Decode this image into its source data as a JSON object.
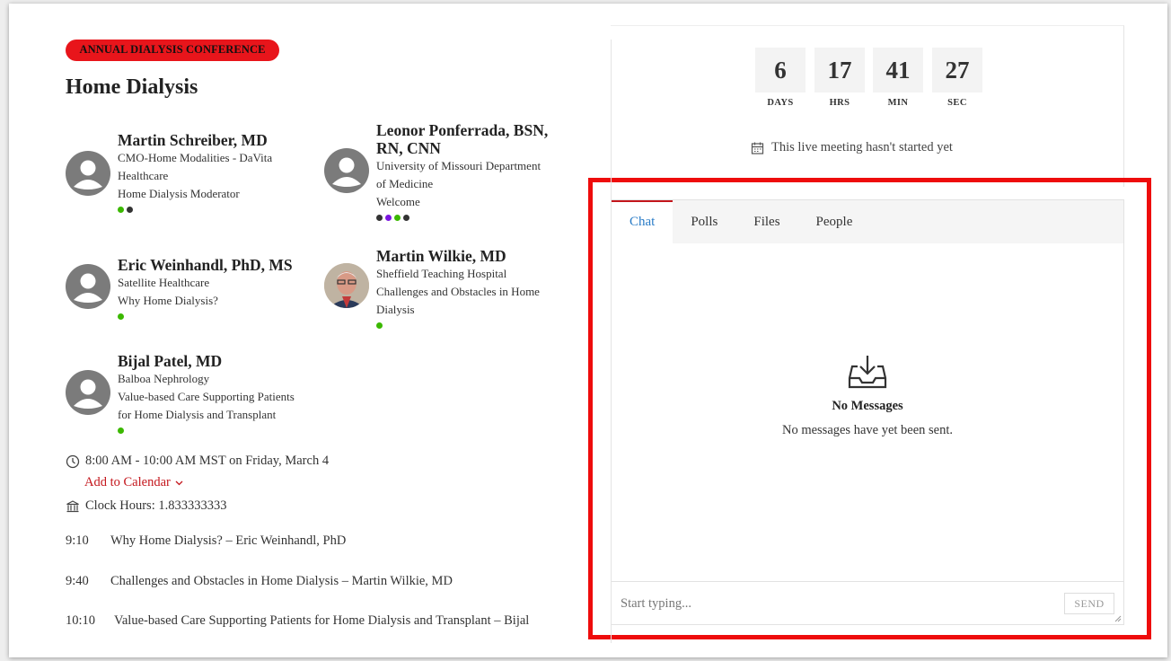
{
  "event": {
    "badge": "ANNUAL DIALYSIS CONFERENCE",
    "title": "Home Dialysis"
  },
  "speakers": [
    {
      "name": "Martin Schreiber, MD",
      "lines": [
        "CMO-Home Modalities - DaVita",
        "Healthcare",
        "Home Dialysis Moderator"
      ],
      "dots": [
        "#3bb800",
        "#333333"
      ]
    },
    {
      "name_lines": [
        "Leonor Ponferrada, BSN,",
        "RN, CNN"
      ],
      "lines": [
        "University of Missouri Department",
        "of Medicine",
        "Welcome"
      ],
      "dots": [
        "#333333",
        "#7b16e0",
        "#3bb800",
        "#333333"
      ]
    },
    {
      "name": "Eric Weinhandl, PhD, MS",
      "lines": [
        "Satellite Healthcare",
        "Why Home Dialysis?"
      ],
      "dots": [
        "#3bb800"
      ]
    },
    {
      "name": "Martin Wilkie, MD",
      "lines": [
        "Sheffield Teaching Hospital",
        "Challenges and Obstacles in Home",
        "Dialysis"
      ],
      "dots": [
        "#3bb800"
      ]
    },
    {
      "name": "Bijal Patel, MD",
      "lines": [
        "Balboa Nephrology",
        "Value-based Care Supporting Patients",
        "for Home Dialysis and Transplant"
      ],
      "dots": [
        "#3bb800"
      ]
    }
  ],
  "time": "8:00 AM - 10:00 AM MST on Friday, March 4",
  "add_to_calendar": "Add to Calendar",
  "clock_hours": "Clock Hours: 1.833333333",
  "schedule": [
    {
      "time": "9:10",
      "text": "Why Home Dialysis? – Eric Weinhandl, PhD"
    },
    {
      "time": "9:40",
      "text": "Challenges and Obstacles in Home Dialysis – Martin Wilkie, MD"
    },
    {
      "time": "10:10",
      "text": "Value-based Care Supporting Patients for Home Dialysis and Transplant – Bijal"
    }
  ],
  "countdown": [
    {
      "value": "6",
      "label": "DAYS"
    },
    {
      "value": "17",
      "label": "HRS"
    },
    {
      "value": "41",
      "label": "MIN"
    },
    {
      "value": "27",
      "label": "SEC"
    }
  ],
  "meeting_status": "This live meeting hasn't started yet",
  "chat": {
    "tabs": [
      "Chat",
      "Polls",
      "Files",
      "People"
    ],
    "active_tab": "Chat",
    "empty_title": "No Messages",
    "empty_subtitle": "No messages have yet been sent.",
    "input_placeholder": "Start typing...",
    "send_label": "SEND"
  },
  "colors": {
    "accent_red": "#e8151b",
    "active_tab": "#2a7cc7",
    "highlight": "#ee0c0c"
  },
  "icons": [
    "clock-icon",
    "calendar-icon",
    "bank-icon",
    "inbox-download-icon",
    "chevron-down-icon",
    "user-avatar-icon"
  ]
}
